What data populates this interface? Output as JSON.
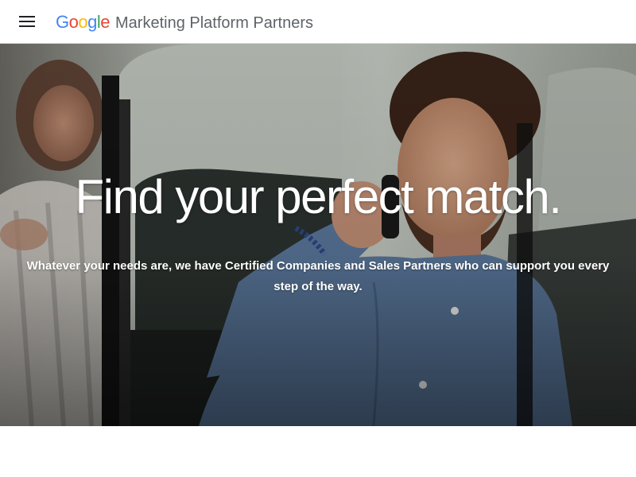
{
  "header": {
    "menu_icon": "hamburger-menu-icon",
    "logo": {
      "letters": [
        {
          "char": "G",
          "color": "#4285F4"
        },
        {
          "char": "o",
          "color": "#EA4335"
        },
        {
          "char": "o",
          "color": "#FBBC05"
        },
        {
          "char": "g",
          "color": "#4285F4"
        },
        {
          "char": "l",
          "color": "#34A853"
        },
        {
          "char": "e",
          "color": "#EA4335"
        }
      ]
    },
    "product_name": "Marketing Platform Partners"
  },
  "hero": {
    "title": "Find your perfect match.",
    "subtitle": "Whatever your needs are, we have Certified Companies and Sales Partners who can support you every step of the way."
  },
  "colors": {
    "header_bg": "#ffffff",
    "product_text": "#5f6368",
    "hero_text": "#ffffff"
  }
}
